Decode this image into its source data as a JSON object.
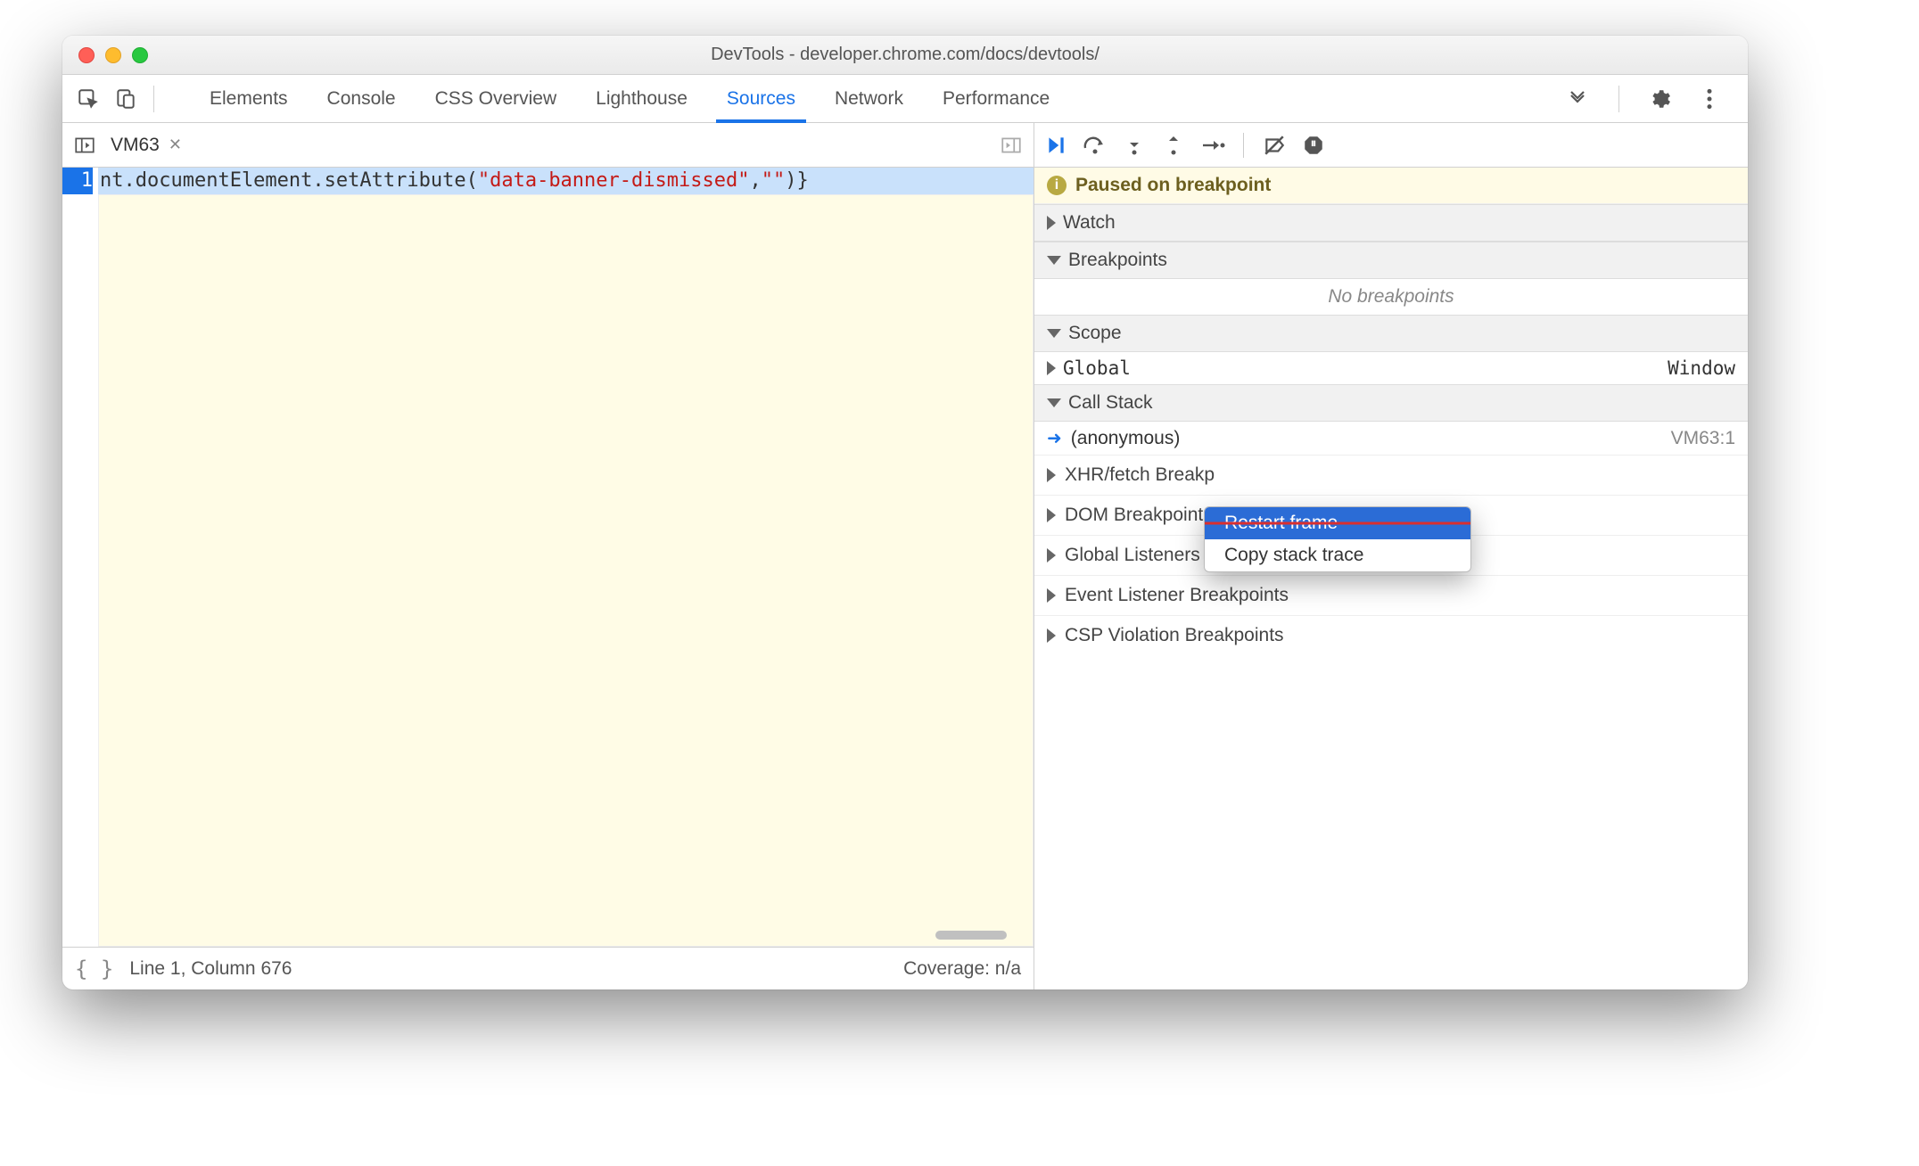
{
  "window": {
    "title": "DevTools - developer.chrome.com/docs/devtools/"
  },
  "toolbar": {
    "tabs": [
      "Elements",
      "Console",
      "CSS Overview",
      "Lighthouse",
      "Sources",
      "Network",
      "Performance"
    ],
    "active_tab_index": 4
  },
  "filetab": {
    "name": "VM63"
  },
  "editor": {
    "line_number": "1",
    "code_prefix": "nt.documentElement.setAttribute(",
    "code_string": "\"data-banner-dismissed\"",
    "code_mid": ",",
    "code_string2": "\"\"",
    "code_suffix": ")}"
  },
  "statusbar": {
    "pretty": "{ }",
    "position": "Line 1, Column 676",
    "coverage": "Coverage: n/a"
  },
  "debugger": {
    "pause_message": "Paused on breakpoint",
    "watch_label": "Watch",
    "breakpoints_label": "Breakpoints",
    "breakpoints_empty": "No breakpoints",
    "scope_label": "Scope",
    "scope_global": "Global",
    "scope_global_val": "Window",
    "callstack_label": "Call Stack",
    "callstack_frame": "(anonymous)",
    "callstack_loc": "VM63:1",
    "xhr_label": "XHR/fetch Breakp",
    "dom_label": "DOM Breakpoints",
    "global_listeners_label": "Global Listeners",
    "event_listener_bp_label": "Event Listener Breakpoints",
    "csp_label": "CSP Violation Breakpoints"
  },
  "context_menu": {
    "restart": "Restart frame",
    "copy": "Copy stack trace"
  }
}
